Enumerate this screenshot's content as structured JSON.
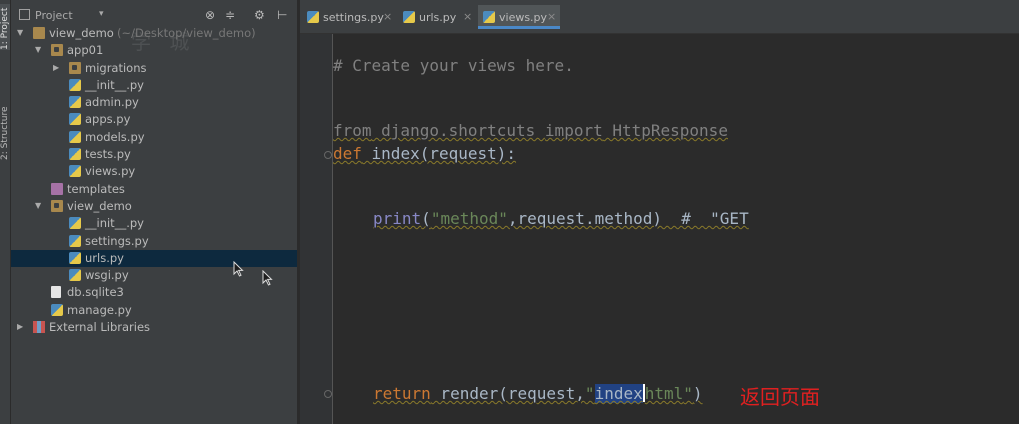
{
  "tool_strip": {
    "project": "1: Project",
    "structure": "2: Structure"
  },
  "project_panel": {
    "title": "Project",
    "dropdown": "▾",
    "tools": [
      "⊗",
      "≑",
      "⚙",
      "⊢"
    ]
  },
  "tree": [
    {
      "name": "view_demo",
      "path": "(~/Desktop/view_demo)",
      "indent": 0,
      "arrow": "▼",
      "icon": "folder"
    },
    {
      "name": "app01",
      "indent": 1,
      "arrow": "▼",
      "icon": "folder-package"
    },
    {
      "name": "migrations",
      "indent": 2,
      "arrow": "▶",
      "icon": "folder-package"
    },
    {
      "name": "__init__.py",
      "indent": 2,
      "icon": "python-file"
    },
    {
      "name": "admin.py",
      "indent": 2,
      "icon": "python-file"
    },
    {
      "name": "apps.py",
      "indent": 2,
      "icon": "python-file"
    },
    {
      "name": "models.py",
      "indent": 2,
      "icon": "python-file"
    },
    {
      "name": "tests.py",
      "indent": 2,
      "icon": "python-file"
    },
    {
      "name": "views.py",
      "indent": 2,
      "icon": "python-file"
    },
    {
      "name": "templates",
      "indent": 1,
      "icon": "templates-folder"
    },
    {
      "name": "view_demo",
      "indent": 1,
      "arrow": "▼",
      "icon": "folder-package"
    },
    {
      "name": "__init__.py",
      "indent": 2,
      "icon": "python-file"
    },
    {
      "name": "settings.py",
      "indent": 2,
      "icon": "python-file"
    },
    {
      "name": "urls.py",
      "indent": 2,
      "icon": "python-file",
      "selected": true
    },
    {
      "name": "wsgi.py",
      "indent": 2,
      "icon": "python-file"
    },
    {
      "name": "db.sqlite3",
      "indent": 1,
      "icon": "file"
    },
    {
      "name": "manage.py",
      "indent": 1,
      "icon": "python-file"
    },
    {
      "name": "External Libraries",
      "indent": 0,
      "arrow": "▶",
      "icon": "library"
    }
  ],
  "editor_tabs": [
    {
      "label": "settings.py",
      "close": "×"
    },
    {
      "label": "urls.py",
      "close": "×"
    },
    {
      "label": "views.py",
      "close": "×",
      "active": true
    }
  ],
  "code": {
    "comment": "# Create your views here.",
    "import_from": "from",
    "import_module": " django.shortcuts ",
    "import_kw": "import",
    "import_name": " HttpResponse",
    "def_kw": "def",
    "def_rest": " index(request):",
    "print_fn": "print",
    "print_open": "(",
    "print_str": "\"method\"",
    "print_rest": ",request.method)  #  \"GET",
    "return_kw": "return",
    "render_a": " render(request,",
    "render_q1": "\"",
    "render_sel": "index",
    "render_b": "html",
    "render_q2": "\"",
    "render_close": ")"
  },
  "annotation": "返回页面",
  "watermark": "学 城"
}
